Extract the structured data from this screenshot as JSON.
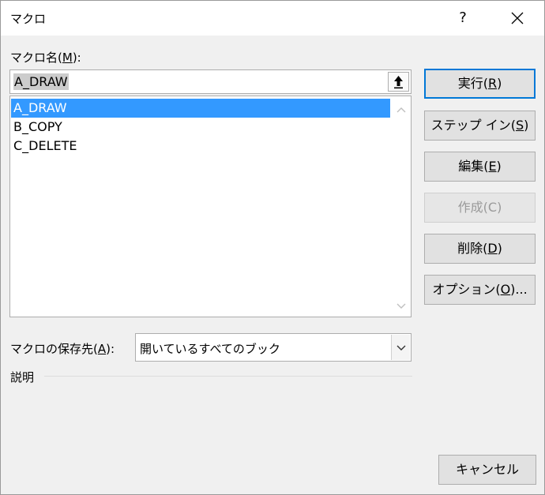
{
  "window": {
    "title": "マクロ",
    "help_glyph": "?"
  },
  "macro_name": {
    "label": "マクロ名(",
    "accel": "M",
    "label_end": "):",
    "value": "A_DRAW"
  },
  "macro_list": [
    "A_DRAW",
    "B_COPY",
    "C_DELETE"
  ],
  "selected_index": 0,
  "buttons": {
    "run": {
      "pre": "実行(",
      "accel": "R",
      "post": ")"
    },
    "step_in": {
      "pre": "ステップ イン(",
      "accel": "S",
      "post": ")"
    },
    "edit": {
      "pre": "編集(",
      "accel": "E",
      "post": ")"
    },
    "create": {
      "pre": "作成(",
      "accel": "C",
      "post": ")"
    },
    "delete": {
      "pre": "削除(",
      "accel": "D",
      "post": ")"
    },
    "options": {
      "pre": "オプション(",
      "accel": "O",
      "post": ")..."
    },
    "cancel": {
      "label": "キャンセル"
    }
  },
  "macros_in": {
    "label": "マクロの保存先(",
    "accel": "A",
    "label_end": "):",
    "value": "開いているすべてのブック"
  },
  "description": {
    "label": "説明"
  },
  "colors": {
    "selection": "#3399ff",
    "default_border": "#0078d7",
    "background": "#f0f0f0"
  }
}
